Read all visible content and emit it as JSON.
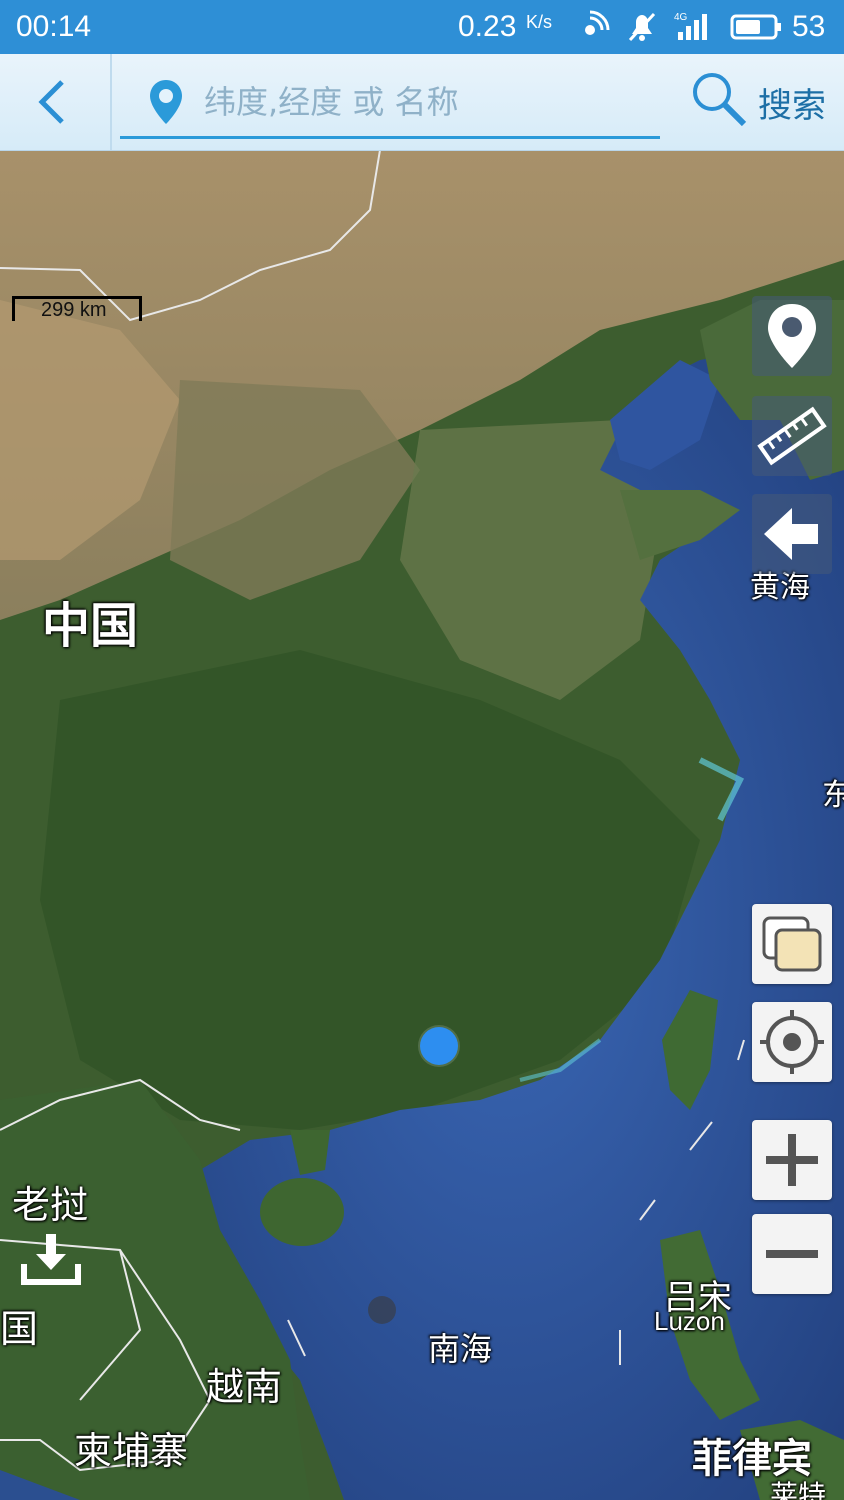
{
  "status_bar": {
    "time": "00:14",
    "speed": "0.23",
    "speed_unit": "K/s",
    "network": "4G",
    "battery": "53"
  },
  "search": {
    "placeholder": "纬度,经度 或 名称",
    "button_label": "搜索"
  },
  "scale": {
    "text": "299 km"
  },
  "map_labels": {
    "china": "中国",
    "laos": "老挝",
    "thailand": "国",
    "vietnam": "越南",
    "cambodia": "柬埔寨",
    "yellow_sea": "黄海",
    "south_sea": "南海",
    "luzon_cn": "吕宋",
    "luzon_en": "Luzon",
    "philippines": "菲律宾",
    "east": "东",
    "leyte": "莱特"
  },
  "tools": [
    {
      "name": "marker",
      "icon": "map-marker-icon"
    },
    {
      "name": "ruler",
      "icon": "ruler-icon"
    },
    {
      "name": "back",
      "icon": "back-arrow-icon"
    },
    {
      "name": "layers",
      "icon": "layers-icon"
    },
    {
      "name": "locate",
      "icon": "locate-icon"
    },
    {
      "name": "zoom_in",
      "icon": "plus-icon"
    },
    {
      "name": "zoom_out",
      "icon": "minus-icon"
    }
  ],
  "colors": {
    "status_bar": "#2e8fd6",
    "search_accent": "#2b9ad9",
    "location_dot": "#2d8ef0",
    "ocean": "#2c4f8e",
    "land": "#3e5e30"
  }
}
